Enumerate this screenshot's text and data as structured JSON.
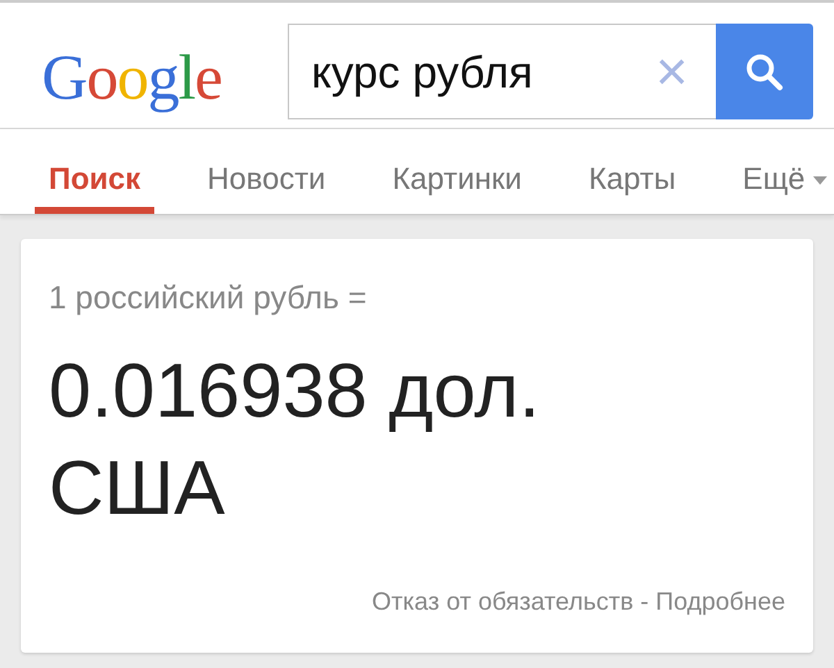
{
  "logo": {
    "letters": [
      {
        "char": "G",
        "color": "#3a6fd8"
      },
      {
        "char": "o",
        "color": "#d64937"
      },
      {
        "char": "o",
        "color": "#f0b400"
      },
      {
        "char": "g",
        "color": "#3a6fd8"
      },
      {
        "char": "l",
        "color": "#2c9a48"
      },
      {
        "char": "e",
        "color": "#d64937"
      }
    ]
  },
  "search": {
    "value": "курс рубля",
    "clear": "×"
  },
  "tabs": [
    {
      "label": "Поиск",
      "selected": true
    },
    {
      "label": "Новости",
      "selected": false
    },
    {
      "label": "Картинки",
      "selected": false
    },
    {
      "label": "Карты",
      "selected": false
    },
    {
      "label": "Ещё",
      "selected": false,
      "kind": "menu"
    }
  ],
  "result": {
    "from": "1 российский рубль =",
    "value": "0.016938 дол. США",
    "footer": "Отказ от обязательств - Подробнее"
  }
}
